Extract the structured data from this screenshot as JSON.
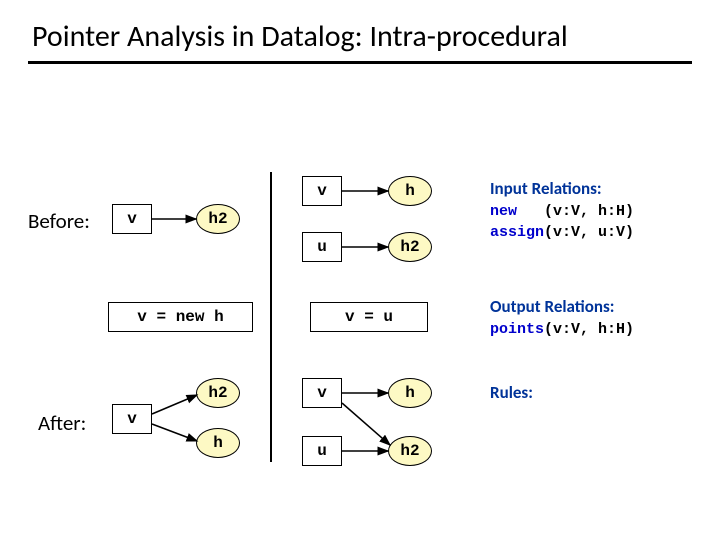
{
  "title": "Pointer Analysis in Datalog: Intra-procedural",
  "labels": {
    "before": "Before:",
    "after": "After:"
  },
  "nodes": {
    "v": "v",
    "h": "h",
    "u": "u",
    "h2": "h2"
  },
  "stmts": {
    "new": "v = new h",
    "assign": "v = u"
  },
  "relations": {
    "input_hdr": "Input Relations:",
    "input1_kw": "new",
    "input1_sig": "(v:V, h:H)",
    "input2_kw": "assign",
    "input2_sig": "(v:V, u:V)",
    "output_hdr": "Output Relations:",
    "output_kw": "points",
    "output_sig": "(v:V, h:H)",
    "rules_hdr": "Rules:"
  }
}
